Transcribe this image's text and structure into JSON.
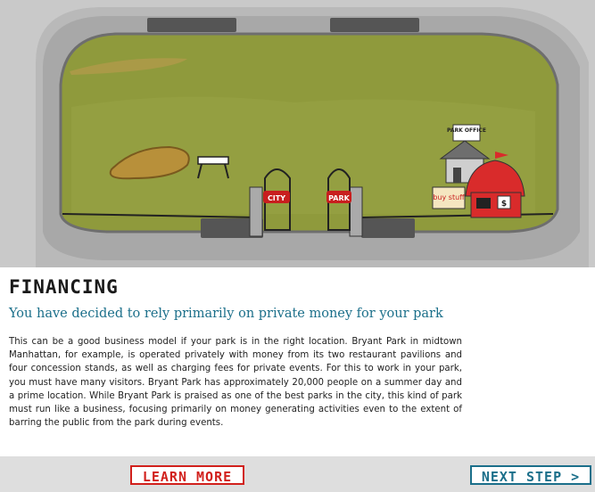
{
  "scene": {
    "signs": {
      "city": "CITY",
      "park": "PARK",
      "office": "PARK OFFICE",
      "buy_stuff": "buy stuff",
      "dollar": "$"
    }
  },
  "content": {
    "heading": "FINANCING",
    "subheading": "You have decided to rely primarily on private money for your park",
    "body": "This can be a good business model if your park is in the right location. Bryant Park in midtown Manhattan, for example, is operated privately with money from its two restaurant pavilions and four concession stands, as well as charging fees for private events. For this to work in your park, you must have many visitors. Bryant Park has approximately 20,000 people on a summer day and a prime location. While Bryant Park is praised as one of the best parks in the city, this kind of park must run like a business, focusing primarily on money generating activities even to the extent of barring the public from the park during events."
  },
  "footer": {
    "learn_more": "LEARN MORE",
    "next_step": "NEXT STEP >"
  },
  "colors": {
    "grass": "#8f9a3c",
    "road": "#b4b4b4",
    "heading_teal": "#1b6f8a",
    "learn_more_red": "#d1201c"
  }
}
